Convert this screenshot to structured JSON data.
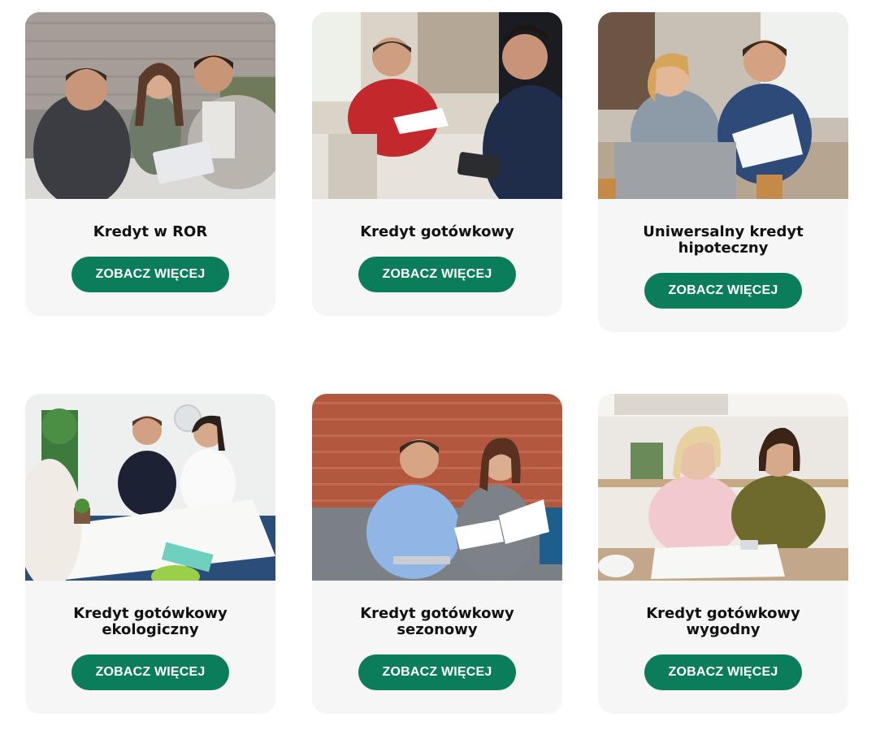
{
  "colors": {
    "button_bg": "#0b7d5b",
    "button_text": "#ffffff",
    "card_bg": "#f6f6f6",
    "title_text": "#111111"
  },
  "cards": [
    {
      "title": "Kredyt w ROR",
      "button_label": "ZOBACZ WIĘCEJ",
      "image_name": "advisor-meeting-couple-photo"
    },
    {
      "title": "Kredyt gotówkowy",
      "button_label": "ZOBACZ WIĘCEJ",
      "image_name": "handshake-document-photo"
    },
    {
      "title": "Uniwersalny kredyt\nhipoteczny",
      "button_label": "ZOBACZ WIĘCEJ",
      "image_name": "couple-reviewing-papers-photo"
    },
    {
      "title": "Kredyt gotówkowy\nekologiczny",
      "button_label": "ZOBACZ WIĘCEJ",
      "image_name": "eco-office-team-photo"
    },
    {
      "title": "Kredyt gotówkowy\nsezonowy",
      "button_label": "ZOBACZ WIĘCEJ",
      "image_name": "couple-on-sofa-documents-photo"
    },
    {
      "title": "Kredyt gotówkowy wygodny",
      "button_label": "ZOBACZ WIĘCEJ",
      "image_name": "women-kitchen-paperwork-photo"
    }
  ]
}
